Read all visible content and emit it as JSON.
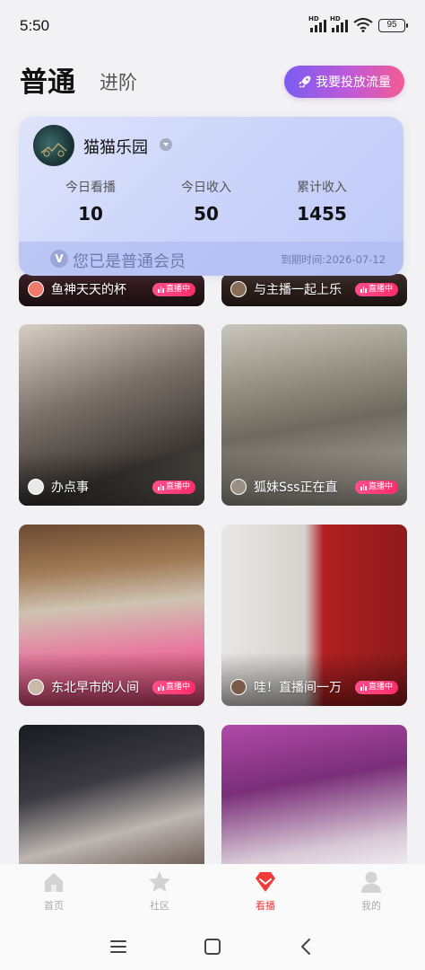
{
  "status_bar": {
    "time": "5:50",
    "signal_label": "HD",
    "battery": "95"
  },
  "header": {
    "tab_normal": "普通",
    "tab_advanced": "进阶",
    "promote_button": "我要投放流量"
  },
  "member": {
    "name": "猫猫乐园",
    "stats": [
      {
        "label": "今日看播",
        "value": "10"
      },
      {
        "label": "今日收入",
        "value": "50"
      },
      {
        "label": "累计收入",
        "value": "1455"
      }
    ],
    "badge": "V",
    "status": "您已是普通会员",
    "expire": "到期时间:2026-07-12"
  },
  "live_badge": "直播中",
  "feed": [
    {
      "name": "鱼神天天的杯",
      "bg": "#3a1f22"
    },
    {
      "name": "与主播一起上乐",
      "bg": "#3b2a24"
    },
    {
      "name": "办点事",
      "bg": "#5a534d"
    },
    {
      "name": "狐妹Sss正在直",
      "bg": "#6f6a60"
    },
    {
      "name": "东北早市的人间",
      "bg": "#8a6a4a"
    },
    {
      "name": "哇！直播间一万",
      "bg": "#8e1b1b"
    },
    {
      "name": "",
      "bg": "#2a2a2c"
    },
    {
      "name": "",
      "bg": "#7a2f78"
    }
  ],
  "bottom_nav": [
    {
      "label": "首页",
      "icon": "home-icon",
      "active": false
    },
    {
      "label": "社区",
      "icon": "star-icon",
      "active": false
    },
    {
      "label": "看播",
      "icon": "diamond-icon",
      "active": true
    },
    {
      "label": "我的",
      "icon": "user-icon",
      "active": false
    }
  ],
  "colors": {
    "accent": "#f23a3a",
    "live_pink": "#ff2d6b",
    "promote_start": "#7b5cf0",
    "promote_end": "#f45b93"
  }
}
